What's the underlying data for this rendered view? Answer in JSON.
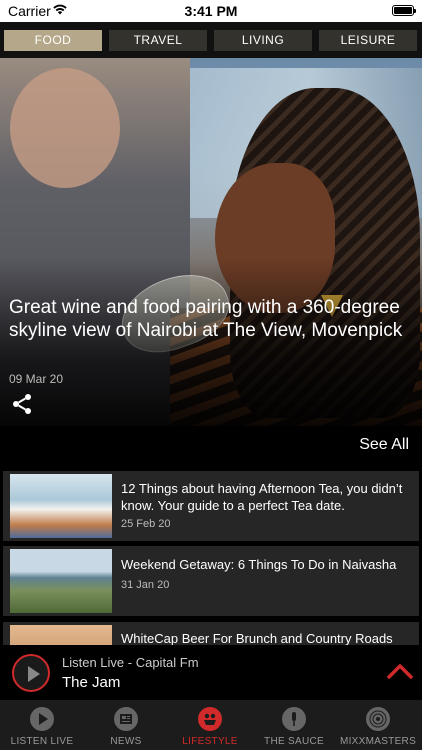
{
  "status_bar": {
    "carrier": "Carrier",
    "time": "3:41 PM"
  },
  "tabs": [
    {
      "label": "FOOD",
      "active": true
    },
    {
      "label": "TRAVEL",
      "active": false
    },
    {
      "label": "LIVING",
      "active": false
    },
    {
      "label": "LEISURE",
      "active": false
    }
  ],
  "hero": {
    "title": "Great wine and food pairing with a 360-degree skyline view of Nairobi at The View, Movenpick",
    "date": "09 Mar 20"
  },
  "see_all": "See All",
  "articles": [
    {
      "title": "12 Things about having Afternoon Tea, you didn’t know. Your guide to a perfect Tea date.",
      "date": "25 Feb 20"
    },
    {
      "title": "Weekend Getaway: 6 Things To Do in Naivasha",
      "date": "31 Jan 20"
    },
    {
      "title": "WhiteCap Beer For Brunch and Country Roads",
      "date": ""
    }
  ],
  "player": {
    "label": "Listen Live - Capital Fm",
    "song": "The Jam"
  },
  "bottom_nav": [
    {
      "label": "LISTEN LIVE",
      "icon": "play-circle-icon",
      "active": false
    },
    {
      "label": "NEWS",
      "icon": "newspaper-icon",
      "active": false
    },
    {
      "label": "LIFESTYLE",
      "icon": "lifestyle-icon",
      "active": true
    },
    {
      "label": "THE SAUCE",
      "icon": "microphone-icon",
      "active": false
    },
    {
      "label": "MIXXMASTERS",
      "icon": "vinyl-record-icon",
      "active": false
    }
  ],
  "colors": {
    "accent_red": "#d12a2a",
    "tab_active": "#b5a88a",
    "tab_inactive": "#34322c"
  }
}
